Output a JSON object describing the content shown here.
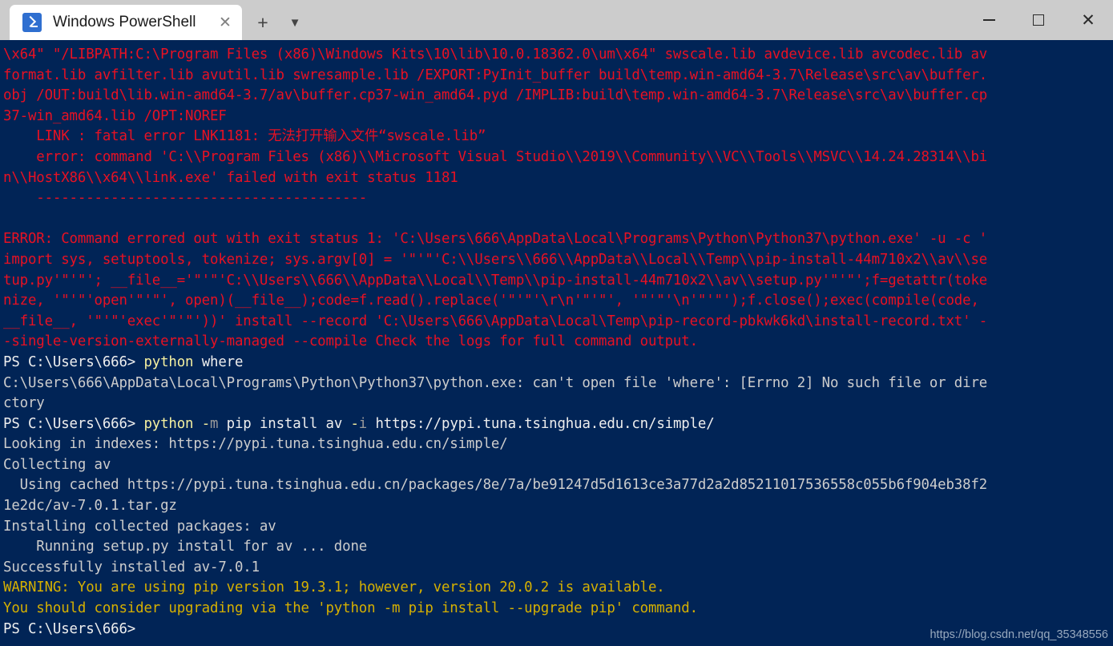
{
  "window": {
    "tab_title": "Windows PowerShell",
    "tab_icon": "powershell-icon",
    "close_tab_icon": "close-icon",
    "new_tab_icon": "plus-icon",
    "tab_menu_icon": "chevron-down-icon",
    "minimize_icon": "minimize-icon",
    "maximize_icon": "maximize-icon",
    "close_icon": "close-icon"
  },
  "colors": {
    "background": "#012456",
    "titlebar": "#cccccc",
    "tab_background": "#ffffff",
    "error_text": "#e81123",
    "output_text": "#cccccc",
    "warning_text": "#d6b000",
    "command_text": "#f5f0a0",
    "parameter_text": "#9a9a9a",
    "accent": "#2f6fd0"
  },
  "watermark": "https://blog.csdn.net/qq_35348556",
  "terminal": {
    "prompt": "PS C:\\Users\\666>",
    "lines": [
      {
        "id": "l1",
        "type": "error",
        "text": "\\x64\" \"/LIBPATH:C:\\Program Files (x86)\\Windows Kits\\10\\lib\\10.0.18362.0\\um\\x64\" swscale.lib avdevice.lib avcodec.lib av"
      },
      {
        "id": "l2",
        "type": "error",
        "text": "format.lib avfilter.lib avutil.lib swresample.lib /EXPORT:PyInit_buffer build\\temp.win-amd64-3.7\\Release\\src\\av\\buffer."
      },
      {
        "id": "l3",
        "type": "error",
        "text": "obj /OUT:build\\lib.win-amd64-3.7/av\\buffer.cp37-win_amd64.pyd /IMPLIB:build\\temp.win-amd64-3.7\\Release\\src\\av\\buffer.cp"
      },
      {
        "id": "l4",
        "type": "error",
        "text": "37-win_amd64.lib /OPT:NOREF"
      },
      {
        "id": "l5",
        "type": "error",
        "text": "    LINK : fatal error LNK1181: 无法打开输入文件“swscale.lib”"
      },
      {
        "id": "l6",
        "type": "error",
        "text": "    error: command 'C:\\\\Program Files (x86)\\\\Microsoft Visual Studio\\\\2019\\\\Community\\\\VC\\\\Tools\\\\MSVC\\\\14.24.28314\\\\bi"
      },
      {
        "id": "l7",
        "type": "error",
        "text": "n\\\\HostX86\\\\x64\\\\link.exe' failed with exit status 1181"
      },
      {
        "id": "l8",
        "type": "error",
        "text": "    ----------------------------------------"
      },
      {
        "id": "l9",
        "type": "blank",
        "text": ""
      },
      {
        "id": "l10",
        "type": "error",
        "text": "ERROR: Command errored out with exit status 1: 'C:\\Users\\666\\AppData\\Local\\Programs\\Python\\Python37\\python.exe' -u -c '"
      },
      {
        "id": "l11",
        "type": "error",
        "text": "import sys, setuptools, tokenize; sys.argv[0] = '\"'\"'C:\\\\Users\\\\666\\\\AppData\\\\Local\\\\Temp\\\\pip-install-44m710x2\\\\av\\\\se"
      },
      {
        "id": "l12",
        "type": "error",
        "text": "tup.py'\"'\"'; __file__='\"'\"'C:\\\\Users\\\\666\\\\AppData\\\\Local\\\\Temp\\\\pip-install-44m710x2\\\\av\\\\setup.py'\"'\"';f=getattr(toke"
      },
      {
        "id": "l13",
        "type": "error",
        "text": "nize, '\"'\"'open'\"'\"', open)(__file__);code=f.read().replace('\"'\"'\\r\\n'\"'\"', '\"'\"'\\n'\"'\"');f.close();exec(compile(code,"
      },
      {
        "id": "l14",
        "type": "error",
        "text": "__file__, '\"'\"'exec'\"'\"'))' install --record 'C:\\Users\\666\\AppData\\Local\\Temp\\pip-record-pbkwk6kd\\install-record.txt' -"
      },
      {
        "id": "l15",
        "type": "error",
        "text": "-single-version-externally-managed --compile Check the logs for full command output."
      },
      {
        "id": "l16",
        "type": "prompt",
        "prompt": "PS C:\\Users\\666> ",
        "command": "python",
        "args": [
          {
            "text": " where",
            "style": "white"
          }
        ]
      },
      {
        "id": "l17",
        "type": "output",
        "text": "C:\\Users\\666\\AppData\\Local\\Programs\\Python\\Python37\\python.exe: can't open file 'where': [Errno 2] No such file or dire"
      },
      {
        "id": "l18",
        "type": "output",
        "text": "ctory"
      },
      {
        "id": "l19",
        "type": "prompt",
        "prompt": "PS C:\\Users\\666> ",
        "command": "python",
        "args": [
          {
            "text": " -",
            "style": "command"
          },
          {
            "text": "m",
            "style": "param"
          },
          {
            "text": " pip install av ",
            "style": "white"
          },
          {
            "text": "-",
            "style": "command"
          },
          {
            "text": "i",
            "style": "param"
          },
          {
            "text": " https://pypi.tuna.tsinghua.edu.cn/simple/",
            "style": "white"
          }
        ]
      },
      {
        "id": "l20",
        "type": "output",
        "text": "Looking in indexes: https://pypi.tuna.tsinghua.edu.cn/simple/"
      },
      {
        "id": "l21",
        "type": "output",
        "text": "Collecting av"
      },
      {
        "id": "l22",
        "type": "output",
        "text": "  Using cached https://pypi.tuna.tsinghua.edu.cn/packages/8e/7a/be91247d5d1613ce3a77d2a2d85211017536558c055b6f904eb38f2"
      },
      {
        "id": "l23",
        "type": "output",
        "text": "1e2dc/av-7.0.1.tar.gz"
      },
      {
        "id": "l24",
        "type": "output",
        "text": "Installing collected packages: av"
      },
      {
        "id": "l25",
        "type": "output",
        "text": "    Running setup.py install for av ... done"
      },
      {
        "id": "l26",
        "type": "output",
        "text": "Successfully installed av-7.0.1"
      },
      {
        "id": "l27",
        "type": "warning",
        "text": "WARNING: You are using pip version 19.3.1; however, version 20.0.2 is available."
      },
      {
        "id": "l28",
        "type": "warning",
        "text": "You should consider upgrading via the 'python -m pip install --upgrade pip' command."
      },
      {
        "id": "l29",
        "type": "prompt",
        "prompt": "PS C:\\Users\\666>",
        "command": "",
        "args": []
      }
    ]
  }
}
